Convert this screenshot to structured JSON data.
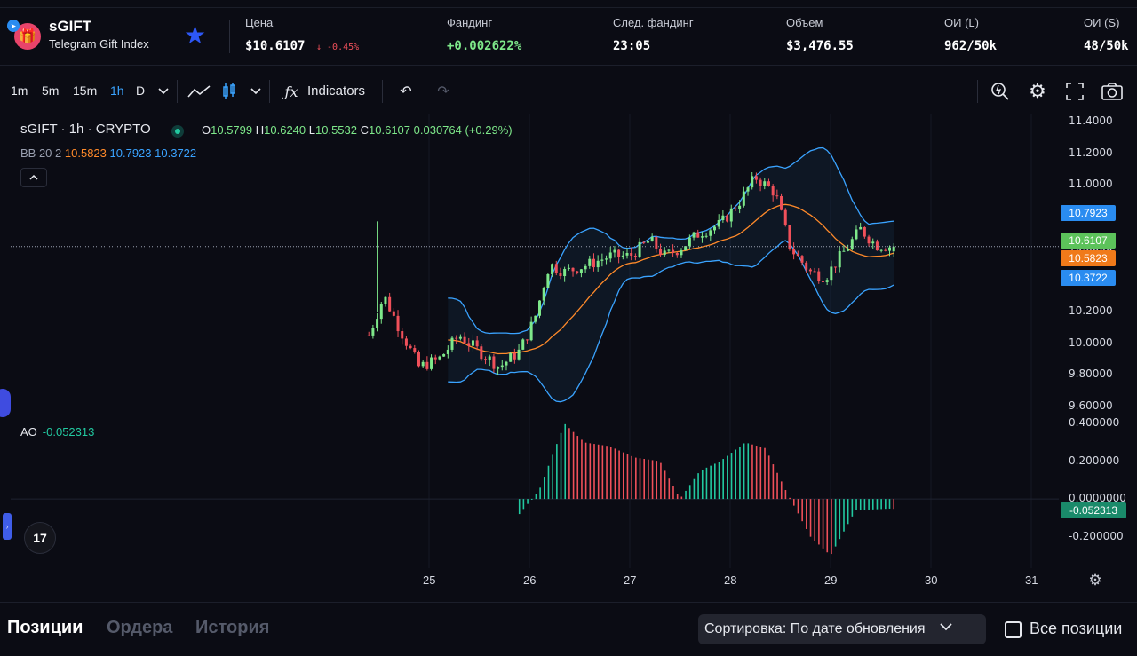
{
  "header": {
    "asset_ticker": "sGIFT",
    "asset_name": "Telegram Gift Index",
    "stats": {
      "price_label": "Цена",
      "price_value": "$10.6107",
      "price_change": "↓ -0.45%",
      "funding_label": "Фандинг",
      "funding_value": "+0.002622%",
      "next_funding_label": "След. фандинг",
      "next_funding_value": "23:05",
      "volume_label": "Объем",
      "volume_value": "$3,476.55",
      "oi_long_label": "ОИ (L)",
      "oi_long_value": "962/50k",
      "oi_short_label": "ОИ (S)",
      "oi_short_value": "48/50k"
    }
  },
  "toolbar": {
    "timeframes": [
      "1m",
      "5m",
      "15m",
      "1h",
      "D"
    ],
    "active_timeframe": "1h",
    "indicators_label": "Indicators",
    "icons": [
      "chevron-down-icon",
      "line-chart-icon",
      "candles-icon",
      "chevron-down-icon",
      "fx-icon",
      "undo-icon",
      "redo-icon",
      "zoom-icon",
      "gear-icon",
      "fullscreen-icon",
      "camera-icon"
    ]
  },
  "legend": {
    "title": "sGIFT · 1h · CRYPTO",
    "open_label": "O",
    "open": "10.5799",
    "high_label": "H",
    "high": "10.6240",
    "low_label": "L",
    "low": "10.5532",
    "close_label": "C",
    "close": "10.6107",
    "change": "0.030764 (+0.29%)",
    "bb_label": "BB 20 2",
    "bb_mid": "10.5823",
    "bb_upper": "10.7923",
    "bb_lower": "10.3722",
    "ao_label": "AO",
    "ao_value": "-0.052313"
  },
  "price_axis": [
    "11.4000",
    "11.2000",
    "11.0000",
    "10.8000",
    "10.6000",
    "10.4000",
    "10.2000",
    "10.0000",
    "9.80000",
    "9.60000"
  ],
  "price_tags": {
    "upper": "10.7923",
    "last": "10.6107",
    "mid": "10.5823",
    "lower": "10.3722",
    "ao": "-0.052313"
  },
  "ao_axis": [
    "0.400000",
    "0.200000",
    "0.0000000",
    "-0.200000"
  ],
  "time_axis": [
    "25",
    "26",
    "27",
    "28",
    "29",
    "30",
    "31"
  ],
  "colors": {
    "up": "#7ee88a",
    "down": "#f0505a",
    "bb_mid": "#ff8a2a",
    "bb_band": "#3aa3ff",
    "ao_up": "#22c9a0",
    "ao_down": "#f0505a"
  },
  "chart_data": {
    "type": "candlestick",
    "timeframe": "1h",
    "bollinger": {
      "period": 20,
      "stddev": 2,
      "mid": 10.5823,
      "upper": 10.7923,
      "lower": 10.3722
    },
    "ao_last": -0.052313,
    "ylim": [
      9.55,
      11.45
    ],
    "ao_ylim": [
      -0.32,
      0.42
    ],
    "anchors": [
      [
        24.4,
        10.05
      ],
      [
        24.55,
        10.3
      ],
      [
        24.7,
        10.1
      ],
      [
        24.9,
        9.85
      ],
      [
        25.1,
        9.9
      ],
      [
        25.3,
        10.05
      ],
      [
        25.5,
        9.95
      ],
      [
        25.7,
        9.85
      ],
      [
        25.9,
        9.95
      ],
      [
        26.05,
        10.15
      ],
      [
        26.2,
        10.5
      ],
      [
        26.35,
        10.45
      ],
      [
        26.6,
        10.5
      ],
      [
        26.8,
        10.55
      ],
      [
        27.0,
        10.55
      ],
      [
        27.2,
        10.65
      ],
      [
        27.35,
        10.55
      ],
      [
        27.5,
        10.6
      ],
      [
        27.7,
        10.7
      ],
      [
        27.9,
        10.75
      ],
      [
        28.1,
        10.9
      ],
      [
        28.25,
        11.05
      ],
      [
        28.45,
        10.95
      ],
      [
        28.6,
        10.6
      ],
      [
        28.8,
        10.45
      ],
      [
        28.95,
        10.42
      ],
      [
        29.1,
        10.55
      ],
      [
        29.3,
        10.72
      ],
      [
        29.45,
        10.62
      ],
      [
        29.63,
        10.61
      ]
    ],
    "ao_anchors": [
      [
        25.9,
        -0.08
      ],
      [
        26.1,
        0.05
      ],
      [
        26.35,
        0.4
      ],
      [
        26.55,
        0.3
      ],
      [
        26.8,
        0.28
      ],
      [
        27.05,
        0.22
      ],
      [
        27.3,
        0.2
      ],
      [
        27.5,
        0.0
      ],
      [
        27.7,
        0.15
      ],
      [
        27.9,
        0.2
      ],
      [
        28.15,
        0.3
      ],
      [
        28.35,
        0.27
      ],
      [
        28.55,
        0.05
      ],
      [
        28.8,
        -0.2
      ],
      [
        29.0,
        -0.3
      ],
      [
        29.25,
        -0.06
      ],
      [
        29.63,
        -0.05
      ]
    ]
  },
  "bottom": {
    "tabs": [
      "Позиции",
      "Ордера",
      "История"
    ],
    "sort_label": "Сортировка: По дате обновления",
    "all_positions_label": "Все позиции"
  }
}
